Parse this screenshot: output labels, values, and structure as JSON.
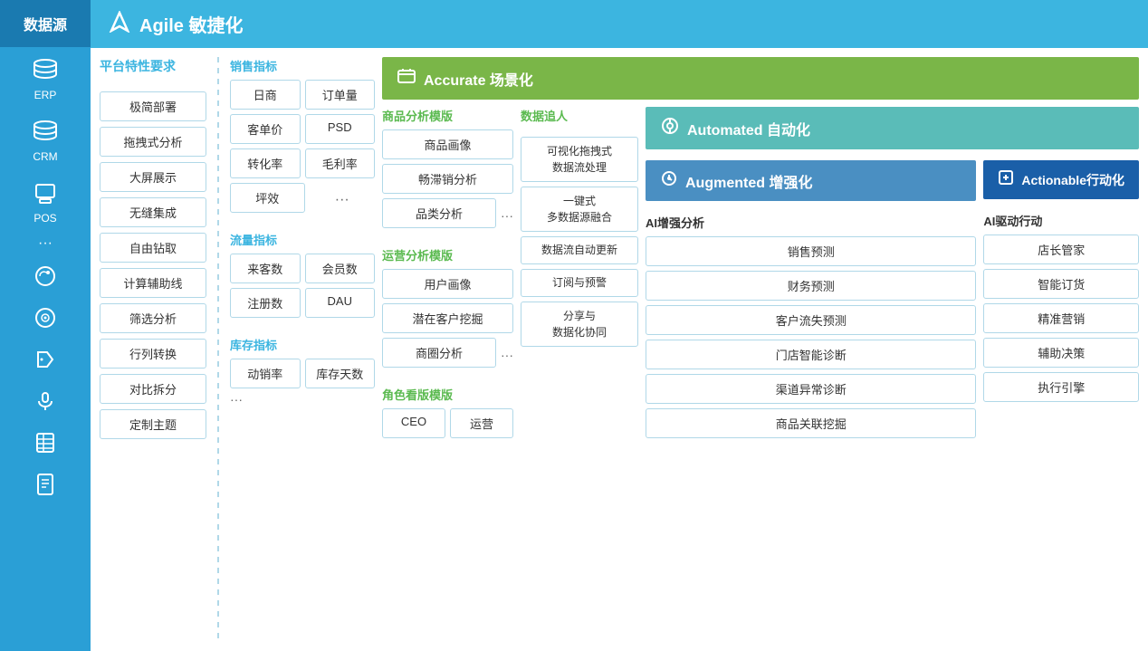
{
  "sidebar": {
    "header": "数据源",
    "items": [
      {
        "label": "ERP",
        "icon": "database"
      },
      {
        "label": "CRM",
        "icon": "database"
      },
      {
        "label": "POS",
        "icon": "database"
      },
      {
        "label": "...",
        "icon": "dots"
      },
      {
        "label": "",
        "icon": "weibo"
      },
      {
        "label": "",
        "icon": "camera"
      },
      {
        "label": "",
        "icon": "tag"
      },
      {
        "label": "",
        "icon": "mic"
      },
      {
        "label": "",
        "icon": "excel"
      },
      {
        "label": "",
        "icon": "doc"
      }
    ]
  },
  "topHeader": {
    "title": "Agile 敏捷化",
    "icon": "navigation"
  },
  "platform": {
    "title": "平台特性要求",
    "items": [
      "极简部署",
      "拖拽式分析",
      "大屏展示",
      "无缝集成",
      "自由钻取",
      "计算辅助线",
      "筛选分析",
      "行列转换",
      "对比拆分",
      "定制主题"
    ]
  },
  "metrics": {
    "sales": {
      "title": "销售指标",
      "items": [
        "日商",
        "订单量",
        "客单价",
        "PSD",
        "转化率",
        "毛利率",
        "坪效",
        "..."
      ]
    },
    "traffic": {
      "title": "流量指标",
      "items": [
        "来客数",
        "会员数",
        "注册数",
        "DAU"
      ]
    },
    "inventory": {
      "title": "库存指标",
      "items": [
        "动销率",
        "库存天数"
      ],
      "dots": "..."
    }
  },
  "accurate": {
    "header": "Accurate 场景化",
    "goods": {
      "title": "商品分析模版",
      "items": [
        "商品画像",
        "畅滞销分析",
        "品类分析",
        "..."
      ]
    },
    "operations": {
      "title": "运营分析模版",
      "items": [
        "用户画像",
        "潜在客户挖掘",
        "商圈分析",
        "..."
      ]
    },
    "roles": {
      "title": "角色看版模版",
      "items": [
        "CEO",
        "运营"
      ]
    }
  },
  "dataTracker": {
    "title": "数据追人",
    "items": [
      "可视化拖拽式\n数据流处理",
      "一键式\n多数据源融合",
      "数据流自动更新",
      "订阅与预警",
      "分享与\n数据化协同"
    ]
  },
  "automated": {
    "header": "Automated 自动化"
  },
  "augmented": {
    "header": "Augmented 增强化",
    "aiTitle": "AI增强分析",
    "items": [
      "销售预测",
      "财务预测",
      "客户流失预测",
      "门店智能诊断",
      "渠道异常诊断",
      "商品关联挖掘"
    ]
  },
  "actionable": {
    "header": "Actionable行动化",
    "aiTitle": "AI驱动行动",
    "items": [
      "店长管家",
      "智能订货",
      "精准营销",
      "辅助决策",
      "执行引擎"
    ]
  }
}
